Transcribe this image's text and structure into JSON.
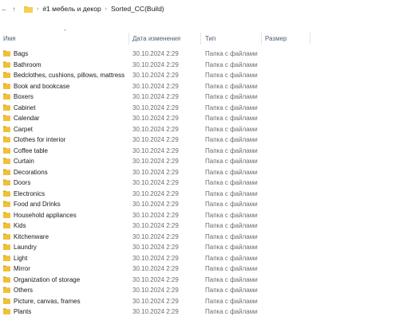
{
  "address": {
    "back_glyph": "←",
    "up_glyph": "↑",
    "separator": "›",
    "crumbs": [
      "#1 мебель и декор",
      "Sorted_CC(Build)"
    ]
  },
  "columns": {
    "name": "Имя",
    "modified": "Дата изменения",
    "type": "Тип",
    "size": "Размер",
    "sort_caret": "^"
  },
  "colors": {
    "folder": "#f2c037",
    "folder_dark": "#d9a520",
    "accent_text": "#4c607a"
  },
  "rows": [
    {
      "name": "Bags",
      "date": "30.10.2024 2:29",
      "type": "Папка с файлами"
    },
    {
      "name": "Bathroom",
      "date": "30.10.2024 2:29",
      "type": "Папка с файлами"
    },
    {
      "name": "Bedclothes, cushions, pillows, mattress",
      "date": "30.10.2024 2:29",
      "type": "Папка с файлами"
    },
    {
      "name": "Book and bookcase",
      "date": "30.10.2024 2:29",
      "type": "Папка с файлами"
    },
    {
      "name": "Boxers",
      "date": "30.10.2024 2:29",
      "type": "Папка с файлами"
    },
    {
      "name": "Cabinet",
      "date": "30.10.2024 2:29",
      "type": "Папка с файлами"
    },
    {
      "name": "Calendar",
      "date": "30.10.2024 2:29",
      "type": "Папка с файлами"
    },
    {
      "name": "Carpet",
      "date": "30.10.2024 2:29",
      "type": "Папка с файлами"
    },
    {
      "name": "Clothes for interior",
      "date": "30.10.2024 2:29",
      "type": "Папка с файлами"
    },
    {
      "name": "Coffee table",
      "date": "30.10.2024 2:29",
      "type": "Папка с файлами"
    },
    {
      "name": "Curtain",
      "date": "30.10.2024 2:29",
      "type": "Папка с файлами"
    },
    {
      "name": "Decorations",
      "date": "30.10.2024 2:29",
      "type": "Папка с файлами"
    },
    {
      "name": "Doors",
      "date": "30.10.2024 2:29",
      "type": "Папка с файлами"
    },
    {
      "name": "Electronics",
      "date": "30.10.2024 2:29",
      "type": "Папка с файлами"
    },
    {
      "name": "Food and Drinks",
      "date": "30.10.2024 2:29",
      "type": "Папка с файлами"
    },
    {
      "name": "Household appliances",
      "date": "30.10.2024 2:29",
      "type": "Папка с файлами"
    },
    {
      "name": "Kids",
      "date": "30.10.2024 2:29",
      "type": "Папка с файлами"
    },
    {
      "name": "Kitchenware",
      "date": "30.10.2024 2:29",
      "type": "Папка с файлами"
    },
    {
      "name": "Laundry",
      "date": "30.10.2024 2:29",
      "type": "Папка с файлами"
    },
    {
      "name": "Light",
      "date": "30.10.2024 2:29",
      "type": "Папка с файлами"
    },
    {
      "name": "Mirror",
      "date": "30.10.2024 2:29",
      "type": "Папка с файлами"
    },
    {
      "name": "Organization of storage",
      "date": "30.10.2024 2:29",
      "type": "Папка с файлами"
    },
    {
      "name": "Others",
      "date": "30.10.2024 2:29",
      "type": "Папка с файлами"
    },
    {
      "name": "Picture, canvas, frames",
      "date": "30.10.2024 2:29",
      "type": "Папка с файлами"
    },
    {
      "name": "Plants",
      "date": "30.10.2024 2:29",
      "type": "Папка с файлами"
    }
  ]
}
